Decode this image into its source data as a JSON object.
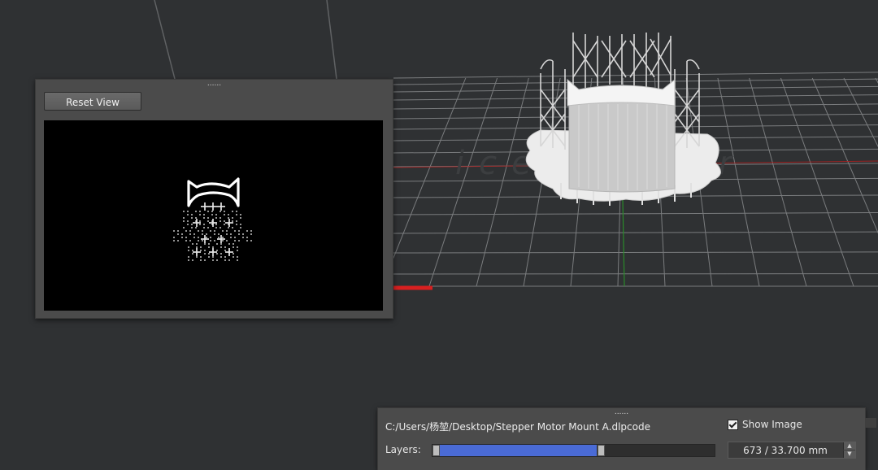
{
  "preview_panel": {
    "grip": "......",
    "reset_view_label": "Reset View"
  },
  "file_panel": {
    "grip": "......",
    "file_path": "C:/Users/杨堃/Desktop/Stepper Motor Mount A.dlpcode",
    "show_image_label": "Show Image",
    "show_image_checked": true,
    "layers_label": "Layers:",
    "layer_value": "673 / 33.700 mm",
    "layer_progress_fraction": 0.59,
    "spin_up": "▲",
    "spin_down": "▼"
  },
  "viewport": {
    "watermark": "ice sl cer",
    "x_axis_color": "#e02020",
    "y_axis_color": "#2aa02a",
    "background_color": "#2f3133"
  }
}
